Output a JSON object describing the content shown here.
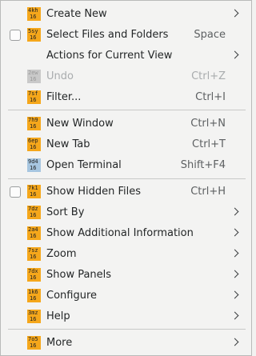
{
  "menu": {
    "items": [
      {
        "label": "Create New",
        "icon": "4kh",
        "submenu": true
      },
      {
        "label": "Select Files and Folders",
        "icon": "5sy",
        "shortcut": "Space",
        "checkbox": true
      },
      {
        "label": "Actions for Current View",
        "submenu": true
      },
      {
        "label": "Undo",
        "icon": "2ew",
        "shortcut": "Ctrl+Z",
        "disabled": true
      },
      {
        "label": "Filter...",
        "icon": "7sf",
        "shortcut": "Ctrl+I"
      },
      {
        "label": "New Window",
        "icon": "7h9",
        "shortcut": "Ctrl+N"
      },
      {
        "label": "New Tab",
        "icon": "6ep",
        "shortcut": "Ctrl+T"
      },
      {
        "label": "Open Terminal",
        "icon": "9d4",
        "shortcut": "Shift+F4"
      },
      {
        "label": "Show Hidden Files",
        "icon": "7k1",
        "shortcut": "Ctrl+H",
        "checkbox": true
      },
      {
        "label": "Sort By",
        "icon": "7dz",
        "submenu": true
      },
      {
        "label": "Show Additional Information",
        "icon": "2a4",
        "submenu": true
      },
      {
        "label": "Zoom",
        "icon": "7sz",
        "submenu": true
      },
      {
        "label": "Show Panels",
        "icon": "7dx",
        "submenu": true
      },
      {
        "label": "Configure",
        "icon": "1k6",
        "submenu": true
      },
      {
        "label": "Help",
        "icon": "3mz",
        "submenu": true
      },
      {
        "label": "More",
        "icon": "7o5",
        "submenu": true
      }
    ],
    "icon_size_label": "16"
  }
}
